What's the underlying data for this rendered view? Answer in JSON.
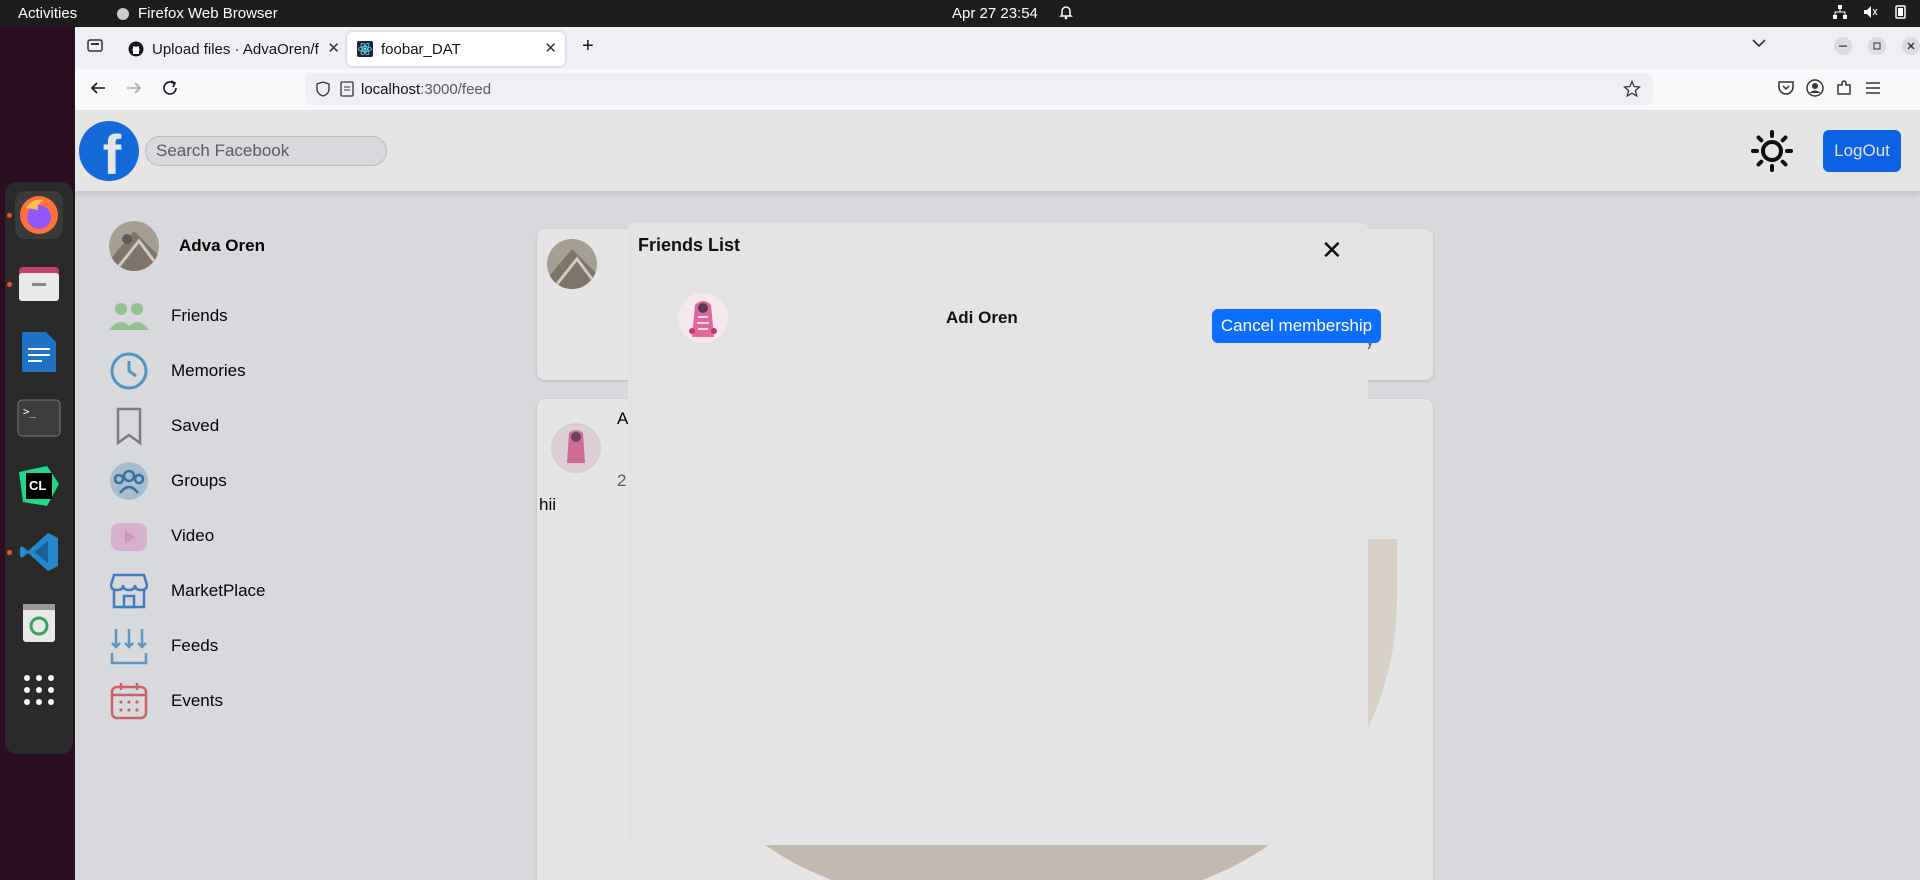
{
  "system": {
    "activities": "Activities",
    "app_name": "Firefox Web Browser",
    "clock": "Apr 27  23:54"
  },
  "browser": {
    "tabs": [
      {
        "label": "Upload files · AdvaOren/f"
      },
      {
        "label": "foobar_DAT"
      }
    ],
    "url_host": "localhost",
    "url_path": ":3000/feed"
  },
  "header": {
    "logo": "f",
    "search_placeholder": "Search Facebook",
    "logout_label": "LogOut"
  },
  "sidebar": {
    "user_name": "Adva Oren",
    "items": [
      {
        "label": "Friends",
        "icon": "friends-icon",
        "color": "#a6d9a6"
      },
      {
        "label": "Memories",
        "icon": "clock-icon",
        "color": "#5ba6d9"
      },
      {
        "label": "Saved",
        "icon": "bookmark-icon",
        "color": "#8a8d91"
      },
      {
        "label": "Groups",
        "icon": "groups-icon",
        "color": "#3c7fb1"
      },
      {
        "label": "Video",
        "icon": "video-icon",
        "color": "#e9a6d9"
      },
      {
        "label": "MarketPlace",
        "icon": "store-icon",
        "color": "#4a8ad9"
      },
      {
        "label": "Feeds",
        "icon": "feeds-icon",
        "color": "#6aa6d9"
      },
      {
        "label": "Events",
        "icon": "calendar-icon",
        "color": "#e07070"
      }
    ]
  },
  "feed": {
    "post_author_initial": "A",
    "post_date_initial": "2",
    "post_text": "hii",
    "partial_text": "ty"
  },
  "modal": {
    "title": "Friends List",
    "close": "✕",
    "friends": [
      {
        "name": "Adi Oren",
        "action_label": "Cancel membership"
      }
    ]
  },
  "colors": {
    "accent": "#0d6efd",
    "fb_blue": "#1877f2"
  }
}
